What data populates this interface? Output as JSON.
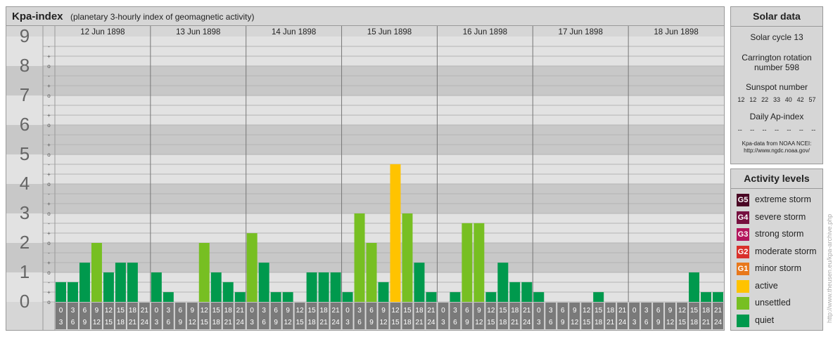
{
  "header": {
    "title": "Kpa-index",
    "subtitle": "(planetary 3-hourly index of geomagnetic activity)"
  },
  "chart_data": {
    "type": "bar",
    "title": "Kpa-index",
    "subtitle": "(planetary 3-hourly index of geomagnetic activity)",
    "ylim": [
      0,
      9
    ],
    "y_ticks": [
      "0",
      "1",
      "2",
      "3",
      "4",
      "5",
      "6",
      "7",
      "8",
      "9"
    ],
    "minor_tick_labels": [
      "o",
      "+",
      "-"
    ],
    "days": [
      "12 Jun 1898",
      "13 Jun 1898",
      "14 Jun 1898",
      "15 Jun 1898",
      "16 Jun 1898",
      "17 Jun 1898",
      "18 Jun 1898"
    ],
    "hour_start_labels": [
      "0",
      "3",
      "6",
      "9",
      "12",
      "15",
      "18",
      "21"
    ],
    "hour_end_labels": [
      "3",
      "6",
      "9",
      "12",
      "15",
      "18",
      "21",
      "24"
    ],
    "values": [
      [
        0.67,
        0.67,
        1.33,
        2.0,
        1.0,
        1.33,
        1.33,
        0.0
      ],
      [
        1.0,
        0.33,
        0.0,
        0.0,
        2.0,
        1.0,
        0.67,
        0.33
      ],
      [
        2.33,
        1.33,
        0.33,
        0.33,
        0.0,
        1.0,
        1.0,
        1.0
      ],
      [
        0.33,
        3.0,
        2.0,
        0.67,
        4.67,
        3.0,
        1.33,
        0.33
      ],
      [
        0.0,
        0.33,
        2.67,
        2.67,
        0.33,
        1.33,
        0.67,
        0.67
      ],
      [
        0.33,
        0.0,
        0.0,
        0.0,
        0.0,
        0.33,
        0.0,
        0.0
      ],
      [
        0.0,
        0.0,
        0.0,
        0.0,
        0.0,
        1.0,
        0.33,
        0.33
      ]
    ],
    "colors": {
      "quiet": "#00994d",
      "unsettled": "#77bf22",
      "active": "#ffc300",
      "minor_storm": "#e8781b",
      "moderate_storm": "#d9302a",
      "strong_storm": "#b3145c",
      "severe_storm": "#76103f",
      "extreme_storm": "#4a0624"
    }
  },
  "solar_data": {
    "title": "Solar data",
    "solar_cycle": "Solar cycle 13",
    "carrington_line1": "Carrington rotation",
    "carrington_line2": "number 598",
    "sunspot_label": "Sunspot number",
    "sunspot_values": [
      "12",
      "12",
      "22",
      "33",
      "40",
      "42",
      "57"
    ],
    "ap_label": "Daily Ap-index",
    "ap_values": [
      "--",
      "--",
      "--",
      "--",
      "--",
      "--",
      "--"
    ],
    "source_line1": "Kpa-data from NOAA NCEI:",
    "source_line2": "http://www.ngdc.noaa.gov/"
  },
  "activity_levels": {
    "title": "Activity levels",
    "items": [
      {
        "code": "G5",
        "label": "extreme storm",
        "color": "#4a0624"
      },
      {
        "code": "G4",
        "label": "severe storm",
        "color": "#76103f"
      },
      {
        "code": "G3",
        "label": "strong storm",
        "color": "#b3145c"
      },
      {
        "code": "G2",
        "label": "moderate storm",
        "color": "#d9302a"
      },
      {
        "code": "G1",
        "label": "minor storm",
        "color": "#e8781b"
      },
      {
        "code": "",
        "label": "active",
        "color": "#ffc300"
      },
      {
        "code": "",
        "label": "unsettled",
        "color": "#77bf22"
      },
      {
        "code": "",
        "label": "quiet",
        "color": "#00994d"
      }
    ]
  },
  "credit": "http://www.theusen.eu/kpa-archive.php"
}
